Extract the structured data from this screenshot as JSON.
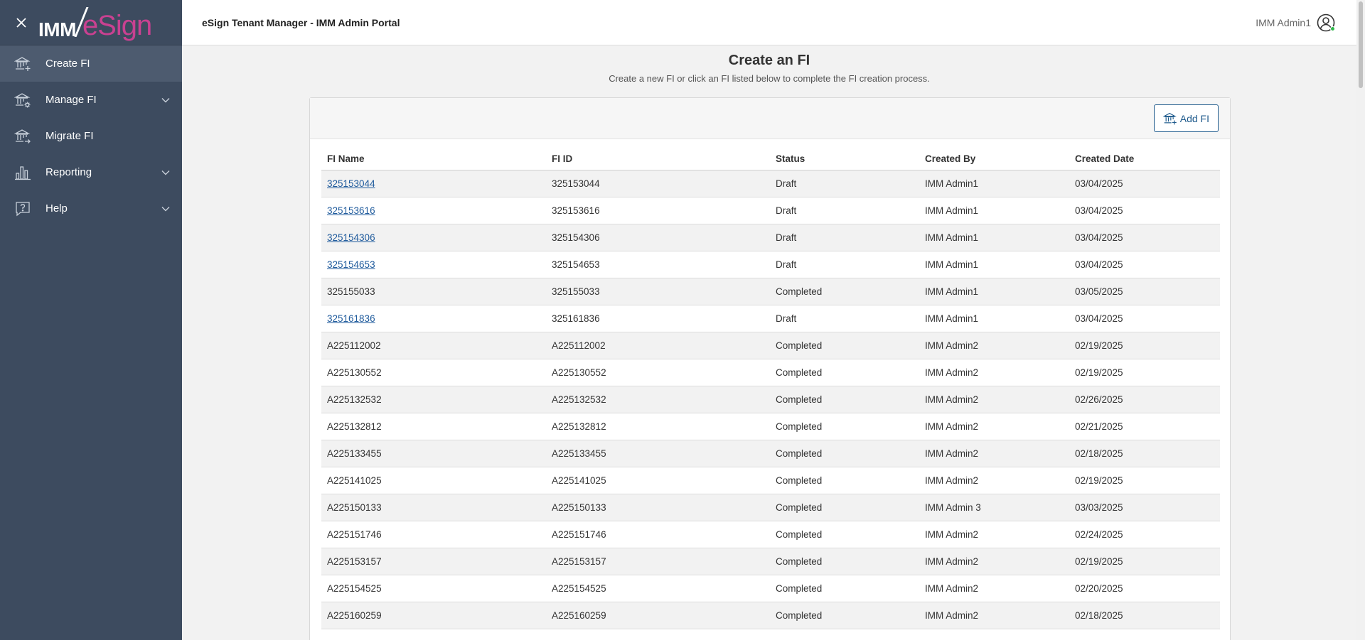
{
  "sidebar": {
    "logo_left": "IMM",
    "logo_right": "eSign",
    "items": [
      {
        "label": "Create FI",
        "icon": "bank-add-icon",
        "has_chevron": false,
        "active": true
      },
      {
        "label": "Manage FI",
        "icon": "bank-gear-icon",
        "has_chevron": true,
        "active": false
      },
      {
        "label": "Migrate FI",
        "icon": "bank-arrow-icon",
        "has_chevron": false,
        "active": false
      },
      {
        "label": "Reporting",
        "icon": "bar-chart-icon",
        "has_chevron": true,
        "active": false
      },
      {
        "label": "Help",
        "icon": "help-icon",
        "has_chevron": true,
        "active": false
      }
    ]
  },
  "topbar": {
    "title": "eSign Tenant Manager - IMM Admin Portal",
    "user_name": "IMM Admin1"
  },
  "main": {
    "title": "Create an FI",
    "subtitle": "Create a new FI or click an FI listed below to complete the FI creation process.",
    "add_button_label": "Add FI",
    "table": {
      "headers": [
        "FI Name",
        "FI ID",
        "Status",
        "Created By",
        "Created Date"
      ],
      "rows": [
        {
          "name": "325153044",
          "link": true,
          "id": "325153044",
          "status": "Draft",
          "created_by": "IMM Admin1",
          "created_date": "03/04/2025"
        },
        {
          "name": "325153616",
          "link": true,
          "id": "325153616",
          "status": "Draft",
          "created_by": "IMM Admin1",
          "created_date": "03/04/2025"
        },
        {
          "name": "325154306",
          "link": true,
          "id": "325154306",
          "status": "Draft",
          "created_by": "IMM Admin1",
          "created_date": "03/04/2025"
        },
        {
          "name": "325154653",
          "link": true,
          "id": "325154653",
          "status": "Draft",
          "created_by": "IMM Admin1",
          "created_date": "03/04/2025"
        },
        {
          "name": "325155033",
          "link": false,
          "id": "325155033",
          "status": "Completed",
          "created_by": "IMM Admin1",
          "created_date": "03/05/2025"
        },
        {
          "name": "325161836",
          "link": true,
          "id": "325161836",
          "status": "Draft",
          "created_by": "IMM Admin1",
          "created_date": "03/04/2025"
        },
        {
          "name": "A225112002",
          "link": false,
          "id": "A225112002",
          "status": "Completed",
          "created_by": "IMM Admin2",
          "created_date": "02/19/2025"
        },
        {
          "name": "A225130552",
          "link": false,
          "id": "A225130552",
          "status": "Completed",
          "created_by": "IMM Admin2",
          "created_date": "02/19/2025"
        },
        {
          "name": "A225132532",
          "link": false,
          "id": "A225132532",
          "status": "Completed",
          "created_by": "IMM Admin2",
          "created_date": "02/26/2025"
        },
        {
          "name": "A225132812",
          "link": false,
          "id": "A225132812",
          "status": "Completed",
          "created_by": "IMM Admin2",
          "created_date": "02/21/2025"
        },
        {
          "name": "A225133455",
          "link": false,
          "id": "A225133455",
          "status": "Completed",
          "created_by": "IMM Admin2",
          "created_date": "02/18/2025"
        },
        {
          "name": "A225141025",
          "link": false,
          "id": "A225141025",
          "status": "Completed",
          "created_by": "IMM Admin2",
          "created_date": "02/19/2025"
        },
        {
          "name": "A225150133",
          "link": false,
          "id": "A225150133",
          "status": "Completed",
          "created_by": "IMM Admin 3",
          "created_date": "03/03/2025"
        },
        {
          "name": "A225151746",
          "link": false,
          "id": "A225151746",
          "status": "Completed",
          "created_by": "IMM Admin2",
          "created_date": "02/24/2025"
        },
        {
          "name": "A225153157",
          "link": false,
          "id": "A225153157",
          "status": "Completed",
          "created_by": "IMM Admin2",
          "created_date": "02/19/2025"
        },
        {
          "name": "A225154525",
          "link": false,
          "id": "A225154525",
          "status": "Completed",
          "created_by": "IMM Admin2",
          "created_date": "02/20/2025"
        },
        {
          "name": "A225160259",
          "link": false,
          "id": "A225160259",
          "status": "Completed",
          "created_by": "IMM Admin2",
          "created_date": "02/18/2025"
        }
      ]
    }
  },
  "colors": {
    "sidebar_bg": "#3d4b5f",
    "sidebar_active": "#4d5b6f",
    "link": "#1e5a9c",
    "brand_pink": "#c94191",
    "online_dot": "#2eb84a"
  }
}
